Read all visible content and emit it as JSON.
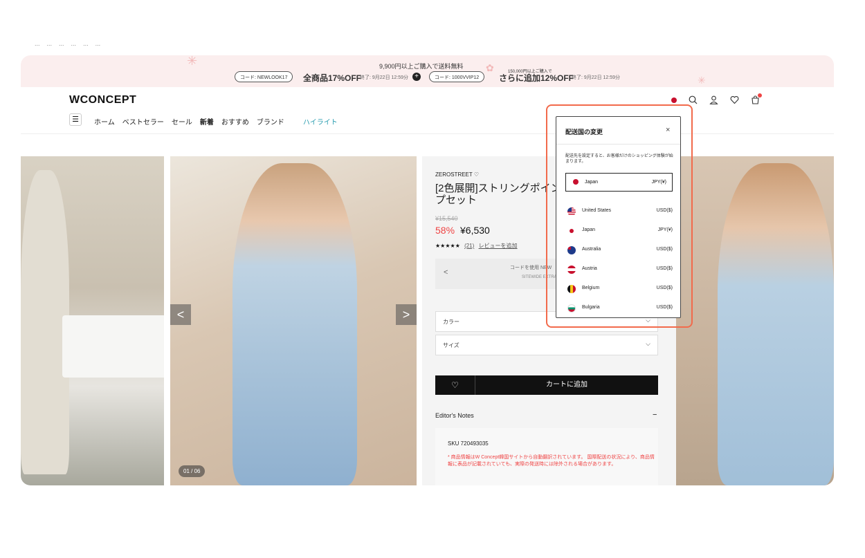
{
  "bookmarks": [
    "...",
    "...",
    "...",
    "...",
    "...",
    "..."
  ],
  "promo": {
    "line1": "9,900円以上ご購入で送料無料",
    "line2": "150,000円以上ご購入で",
    "code1": "コード: NEWLOOK17",
    "offer1": "全商品17%OFF",
    "deadline1": "終了: 9月22日 12:59分",
    "code2": "コード: 1000VVIP12",
    "offer2": "さらに追加12%OFF",
    "deadline2": "終了: 9月22日 12:59分",
    "plus": "+"
  },
  "header": {
    "logo": "WCONCEPT",
    "menu_icon": "☰",
    "nav": [
      "ホーム",
      "ベストセラー",
      "セール",
      "新着",
      "おすすめ",
      "ブランド"
    ],
    "highlight": "ハイライト"
  },
  "gallery": {
    "prev": "<",
    "next": ">",
    "counter": "01 / 06"
  },
  "product": {
    "brand": "ZEROSTREET ♡",
    "title": "[2色展開]ストリングポイン プセット",
    "old_price": "¥15,540",
    "discount": "58%",
    "price": "¥6,530",
    "stars": "★★★★★",
    "review_count": "(21)",
    "review_link": "レビューを追加",
    "coupon_line1": "コードを使用 NEW",
    "coupon_line2": "SITEWIDE EXTRA",
    "coupon_prev": "<",
    "color_label": "カラー",
    "size_label": "サイズ",
    "heart": "♡",
    "cart_label": "カートに追加",
    "notes_title": "Editor's Notes",
    "notes_toggle": "−",
    "sku": "SKU 720493035",
    "warning": "* 商品情報はW Concept韓国サイトから自動翻訳されています。 国際配送の状況により、商品情報に表品が記載されていても、実際の発送時には除外される場合があります。"
  },
  "modal": {
    "title": "配送国の変更",
    "close": "×",
    "description": "配送先を設定すると、お客様だけのショッピング体験が始まります。",
    "selected": {
      "country": "Japan",
      "currency": "JPY(¥)"
    },
    "countries": [
      {
        "name": "United States",
        "currency": "USD($)",
        "flag": "us"
      },
      {
        "name": "Japan",
        "currency": "JPY(¥)",
        "flag": "jp"
      },
      {
        "name": "Australia",
        "currency": "USD($)",
        "flag": "au"
      },
      {
        "name": "Austria",
        "currency": "USD($)",
        "flag": "at"
      },
      {
        "name": "Belgium",
        "currency": "USD($)",
        "flag": "be"
      },
      {
        "name": "Bulgaria",
        "currency": "USD($)",
        "flag": "bg"
      }
    ]
  },
  "colors": {
    "accent_red": "#ef4444",
    "highlight_box": "#f26a4b",
    "highlight_nav": "#2a9db0",
    "promo_bg": "#fbeeee"
  }
}
